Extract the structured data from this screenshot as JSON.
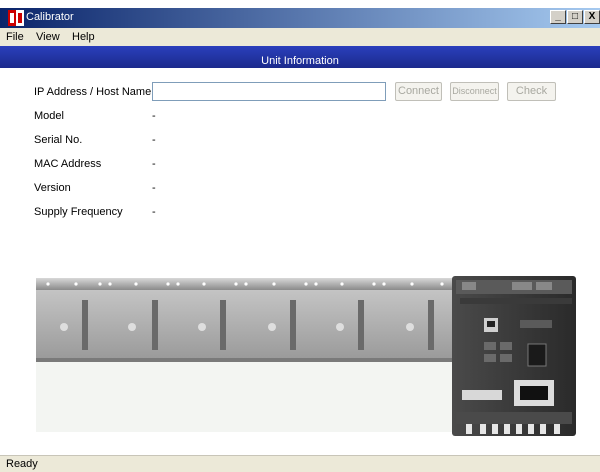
{
  "window": {
    "title": "Calibrator",
    "controls": {
      "minimize": "_",
      "maximize": "□",
      "close": "X"
    }
  },
  "menu": {
    "items": [
      "File",
      "View",
      "Help"
    ]
  },
  "section": {
    "title": "Unit Information"
  },
  "form": {
    "ip_label": "IP Address / Host Name",
    "ip_value": "",
    "connect_label": "Connect",
    "disconnect_label": "Disconnect",
    "check_label": "Check",
    "fields": [
      {
        "label": "Model",
        "value": "-"
      },
      {
        "label": "Serial No.",
        "value": "-"
      },
      {
        "label": "MAC Address",
        "value": "-"
      },
      {
        "label": "Version",
        "value": "-"
      },
      {
        "label": "Supply Frequency",
        "value": "-"
      }
    ]
  },
  "status": {
    "text": "Ready"
  },
  "device_image": {
    "icon": "device-rack-illustration"
  },
  "colors": {
    "titlebar_start": "#0a246a",
    "titlebar_end": "#a6caf0",
    "section_bar": "#2a3fbc",
    "chrome": "#ece9d8"
  }
}
